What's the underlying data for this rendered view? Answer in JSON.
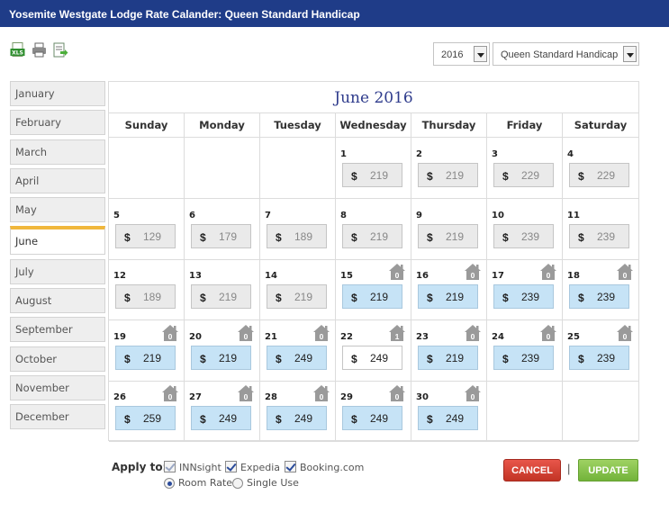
{
  "window": {
    "title": "Yosemite Westgate Lodge Rate Calander: Queen Standard Handicap"
  },
  "toolbar": {
    "icons": [
      "xls-export-icon",
      "print-icon",
      "export-icon"
    ],
    "year": "2016",
    "room_type": "Queen Standard Handicap"
  },
  "months": [
    "January",
    "February",
    "March",
    "April",
    "May",
    "June",
    "July",
    "August",
    "September",
    "October",
    "November",
    "December"
  ],
  "selected_month": "June",
  "calendar": {
    "title": "June 2016",
    "weekdays": [
      "Sunday",
      "Monday",
      "Tuesday",
      "Wednesday",
      "Thursday",
      "Friday",
      "Saturday"
    ],
    "first_weekday_index": 3,
    "currency": "$",
    "days": [
      {
        "day": "1",
        "rate": "219",
        "state": "past"
      },
      {
        "day": "2",
        "rate": "219",
        "state": "past"
      },
      {
        "day": "3",
        "rate": "229",
        "state": "past"
      },
      {
        "day": "4",
        "rate": "229",
        "state": "past"
      },
      {
        "day": "5",
        "rate": "129",
        "state": "past"
      },
      {
        "day": "6",
        "rate": "179",
        "state": "past"
      },
      {
        "day": "7",
        "rate": "189",
        "state": "past"
      },
      {
        "day": "8",
        "rate": "219",
        "state": "past"
      },
      {
        "day": "9",
        "rate": "219",
        "state": "past"
      },
      {
        "day": "10",
        "rate": "239",
        "state": "past"
      },
      {
        "day": "11",
        "rate": "239",
        "state": "past"
      },
      {
        "day": "12",
        "rate": "189",
        "state": "past"
      },
      {
        "day": "13",
        "rate": "219",
        "state": "past"
      },
      {
        "day": "14",
        "rate": "219",
        "state": "past"
      },
      {
        "day": "15",
        "rate": "219",
        "state": "open",
        "count": "0"
      },
      {
        "day": "16",
        "rate": "219",
        "state": "open",
        "count": "0"
      },
      {
        "day": "17",
        "rate": "239",
        "state": "open",
        "count": "0"
      },
      {
        "day": "18",
        "rate": "239",
        "state": "open",
        "count": "0"
      },
      {
        "day": "19",
        "rate": "219",
        "state": "open",
        "count": "0"
      },
      {
        "day": "20",
        "rate": "219",
        "state": "open",
        "count": "0"
      },
      {
        "day": "21",
        "rate": "249",
        "state": "open",
        "count": "0"
      },
      {
        "day": "22",
        "rate": "249",
        "state": "sold",
        "count": "1"
      },
      {
        "day": "23",
        "rate": "219",
        "state": "open",
        "count": "0"
      },
      {
        "day": "24",
        "rate": "239",
        "state": "open",
        "count": "0"
      },
      {
        "day": "25",
        "rate": "239",
        "state": "open",
        "count": "0"
      },
      {
        "day": "26",
        "rate": "259",
        "state": "open",
        "count": "0"
      },
      {
        "day": "27",
        "rate": "249",
        "state": "open",
        "count": "0"
      },
      {
        "day": "28",
        "rate": "249",
        "state": "open",
        "count": "0"
      },
      {
        "day": "29",
        "rate": "249",
        "state": "open",
        "count": "0"
      },
      {
        "day": "30",
        "rate": "249",
        "state": "open",
        "count": "0"
      }
    ]
  },
  "apply": {
    "label": "Apply to:",
    "channels": [
      {
        "label": "INNsight",
        "checked": true,
        "disabled": true
      },
      {
        "label": "Expedia",
        "checked": true,
        "disabled": false
      },
      {
        "label": "Booking.com",
        "checked": true,
        "disabled": false
      }
    ],
    "modes": [
      {
        "label": "Room Rate",
        "selected": true
      },
      {
        "label": "Single Use",
        "selected": false
      }
    ]
  },
  "actions": {
    "cancel_label": "CANCEL",
    "separator": "|",
    "update_label": "UPDATE"
  },
  "colors": {
    "title_bar": "#1f3c88",
    "month_highlight": "#f0b73c",
    "open_rate_bg": "#c6e3f6",
    "past_rate_bg": "#eaeaea",
    "house_icon": "#9a9a9a",
    "cancel": "#c23425",
    "update": "#72b33a"
  }
}
